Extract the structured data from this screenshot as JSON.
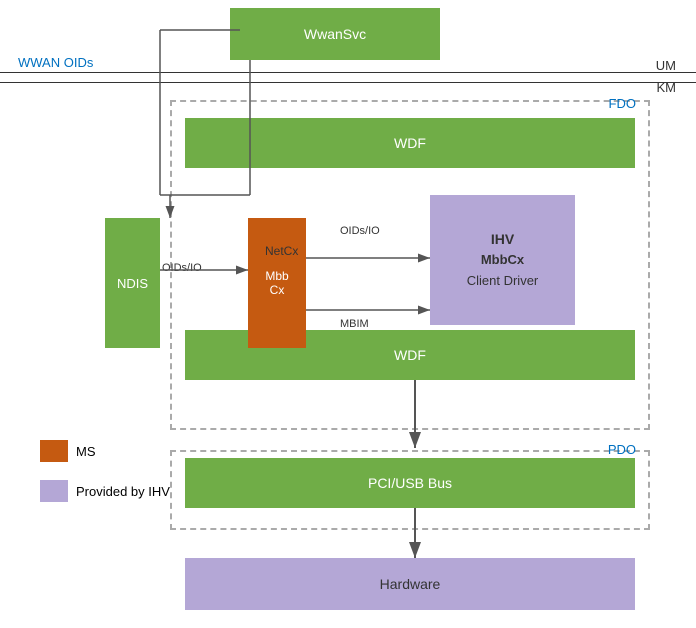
{
  "labels": {
    "wwansvc": "WwanSvc",
    "wwan_oids": "WWAN OIDs",
    "um": "UM",
    "km": "KM",
    "fdo": "FDO",
    "wdf_top": "WDF",
    "wdf_bottom": "WDF",
    "ndis": "NDIS",
    "mbbcx": "Mbb\nCx",
    "netcx": "NetCx",
    "oidsio_top": "OIDs/IO",
    "mbim": "MBIM",
    "oidsio_ndis": "OIDs/IO",
    "ihv_title": "IHV",
    "ihv_sub": "MbbCx",
    "ihv_driver": "Client Driver",
    "pdo": "PDO",
    "pcibus": "PCI/USB Bus",
    "hardware": "Hardware",
    "legend_ms": "MS",
    "legend_ihv": "Provided by IHV"
  },
  "colors": {
    "green": "#70ad47",
    "orange": "#c55a11",
    "purple": "#b4a7d6",
    "blue_label": "#0070c0",
    "text_dark": "#333333",
    "text_white": "#ffffff"
  }
}
